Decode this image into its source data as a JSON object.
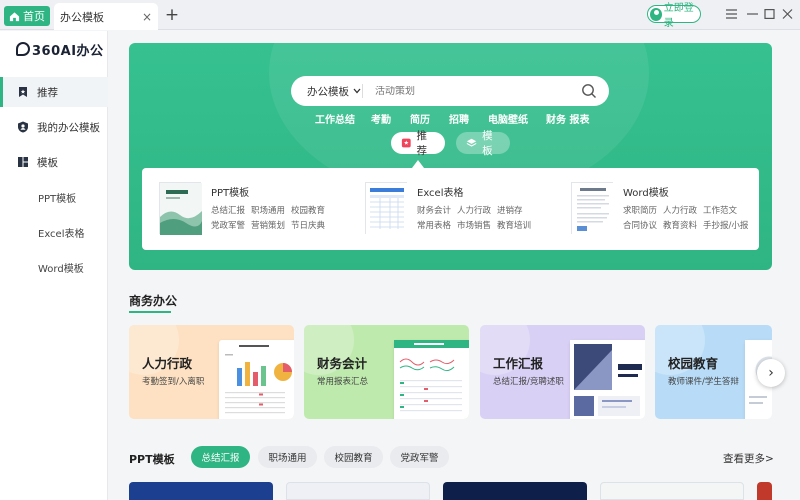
{
  "titlebar": {
    "home_tab": "首页",
    "active_tab": "办公模板",
    "close_glyph": "×",
    "add_glyph": "+",
    "login": "立即登录"
  },
  "sidebar": {
    "logo": "360AI办公",
    "items": [
      {
        "label": "推荐",
        "icon": "bookmark-icon"
      },
      {
        "label": "我的办公模板",
        "icon": "shield-user-icon"
      },
      {
        "label": "模板",
        "icon": "grid-icon"
      }
    ],
    "sub_items": [
      "PPT模板",
      "Excel表格",
      "Word模板"
    ]
  },
  "hero": {
    "search_category": "办公模板",
    "search_placeholder": "活动策划",
    "hot_keywords": [
      "工作总结",
      "考勤",
      "简历",
      "招聘",
      "电脑壁纸",
      "财务 报表"
    ],
    "pill_recommend": "推荐",
    "pill_template": "模板",
    "categories": [
      {
        "title": "PPT模板",
        "links": [
          "总结汇报",
          "职场通用",
          "校园教育",
          "党政军警",
          "营销策划",
          "节日庆典"
        ]
      },
      {
        "title": "Excel表格",
        "links": [
          "财务会计",
          "人力行政",
          "进销存",
          "常用表格",
          "市场销售",
          "教育培训"
        ]
      },
      {
        "title": "Word模板",
        "links": [
          "求职简历",
          "人力行政",
          "工作范文",
          "合同协议",
          "教育资料",
          "手抄报/小报"
        ]
      }
    ]
  },
  "business": {
    "title": "商务办公",
    "cards": [
      {
        "title": "人力行政",
        "subtitle": "考勤签到/入离职",
        "bg": "#fde1c2"
      },
      {
        "title": "财务会计",
        "subtitle": "常用报表汇总",
        "bg": "#bfeaae"
      },
      {
        "title": "工作汇报",
        "subtitle": "总结汇报/竞聘述职",
        "bg": "#d9d0f5"
      },
      {
        "title": "校园教育",
        "subtitle": "教师课件/学生答辩",
        "bg": "#b8dcf7"
      }
    ],
    "next_glyph": "›"
  },
  "ppt": {
    "title": "PPT模板",
    "chips": [
      "总结汇报",
      "职场通用",
      "校园教育",
      "党政军警"
    ],
    "more": "查看更多>"
  },
  "colors": {
    "accent": "#2fb583"
  }
}
